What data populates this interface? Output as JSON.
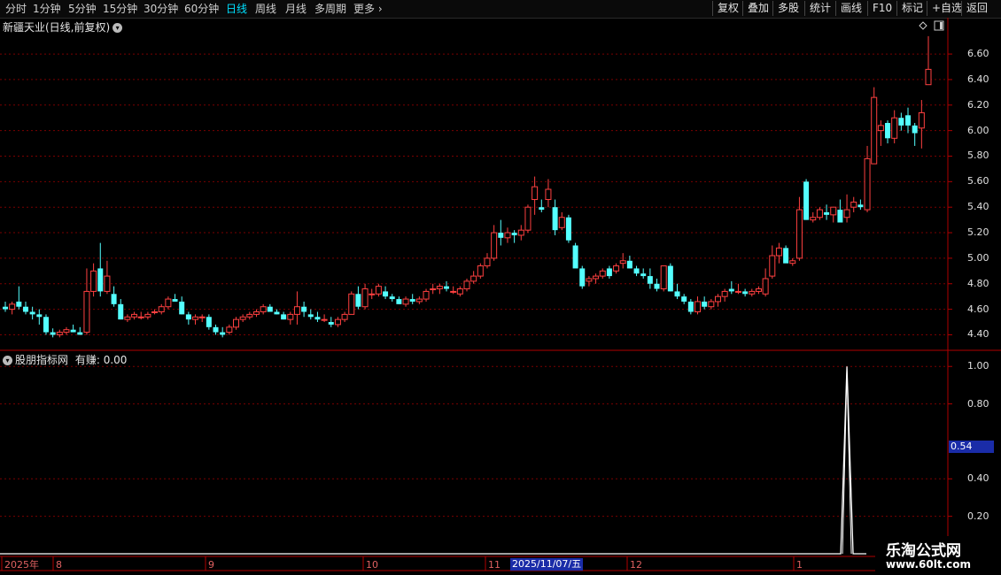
{
  "toolbar": {
    "periods": [
      "分时",
      "1分钟",
      "5分钟",
      "15分钟",
      "30分钟",
      "60分钟",
      "日线",
      "周线",
      "月线",
      "多周期",
      "更多"
    ],
    "active_period": "日线",
    "right_buttons": [
      "复权",
      "叠加",
      "多股",
      "统计",
      "画线",
      "F10",
      "标记",
      "+自选",
      "返回"
    ]
  },
  "main_chart": {
    "title": "新疆天业(日线,前复权)",
    "y_ticks": [
      "6.60",
      "6.40",
      "6.20",
      "6.00",
      "5.80",
      "5.60",
      "5.40",
      "5.20",
      "5.00",
      "4.80",
      "4.60",
      "4.40"
    ]
  },
  "indicator": {
    "title": "股朋指标网",
    "series_label": "有赚: 0.00",
    "y_ticks": [
      "1.00",
      "0.80",
      "0.40",
      "0.20"
    ],
    "cursor_value": "0.54"
  },
  "x_axis": {
    "labels": [
      "2025年",
      "8",
      "9",
      "10",
      "11",
      "12",
      "1"
    ],
    "highlight_date": "2025/11/07/五"
  },
  "watermark": {
    "name": "乐淘公式网",
    "url": "www.60lt.com"
  },
  "colors": {
    "up": "#ff4040",
    "down": "#54ffff",
    "grid": "#7a0000",
    "border": "#b00000"
  },
  "chart_data": {
    "type": "candlestick",
    "ylim": [
      4.32,
      6.76
    ],
    "candles": [
      [
        4.62,
        4.66,
        4.58,
        4.6
      ],
      [
        4.6,
        4.66,
        4.56,
        4.64
      ],
      [
        4.66,
        4.78,
        4.6,
        4.62
      ],
      [
        4.62,
        4.66,
        4.56,
        4.58
      ],
      [
        4.58,
        4.62,
        4.52,
        4.56
      ],
      [
        4.56,
        4.6,
        4.48,
        4.54
      ],
      [
        4.54,
        4.56,
        4.4,
        4.42
      ],
      [
        4.42,
        4.45,
        4.38,
        4.4
      ],
      [
        4.4,
        4.44,
        4.38,
        4.42
      ],
      [
        4.42,
        4.46,
        4.4,
        4.44
      ],
      [
        4.44,
        4.48,
        4.42,
        4.42
      ],
      [
        4.42,
        4.46,
        4.4,
        4.4
      ],
      [
        4.42,
        4.92,
        4.4,
        4.74
      ],
      [
        4.74,
        4.96,
        4.7,
        4.9
      ],
      [
        4.92,
        5.12,
        4.7,
        4.74
      ],
      [
        4.74,
        4.98,
        4.72,
        4.86
      ],
      [
        4.72,
        4.78,
        4.62,
        4.64
      ],
      [
        4.64,
        4.68,
        4.52,
        4.52
      ],
      [
        4.52,
        4.56,
        4.5,
        4.54
      ],
      [
        4.54,
        4.58,
        4.52,
        4.56
      ],
      [
        4.54,
        4.58,
        4.52,
        4.54
      ],
      [
        4.54,
        4.58,
        4.52,
        4.56
      ],
      [
        4.58,
        4.6,
        4.56,
        4.58
      ],
      [
        4.58,
        4.64,
        4.56,
        4.62
      ],
      [
        4.62,
        4.7,
        4.6,
        4.68
      ],
      [
        4.68,
        4.72,
        4.66,
        4.66
      ],
      [
        4.66,
        4.7,
        4.56,
        4.56
      ],
      [
        4.56,
        4.58,
        4.48,
        4.52
      ],
      [
        4.52,
        4.56,
        4.48,
        4.54
      ],
      [
        4.54,
        4.56,
        4.5,
        4.54
      ],
      [
        4.54,
        4.56,
        4.44,
        4.46
      ],
      [
        4.46,
        4.48,
        4.4,
        4.42
      ],
      [
        4.42,
        4.46,
        4.38,
        4.4
      ],
      [
        4.42,
        4.48,
        4.4,
        4.46
      ],
      [
        4.46,
        4.54,
        4.44,
        4.52
      ],
      [
        4.52,
        4.56,
        4.5,
        4.54
      ],
      [
        4.54,
        4.58,
        4.52,
        4.56
      ],
      [
        4.56,
        4.6,
        4.54,
        4.58
      ],
      [
        4.58,
        4.64,
        4.56,
        4.62
      ],
      [
        4.62,
        4.64,
        4.58,
        4.58
      ],
      [
        4.58,
        4.6,
        4.56,
        4.56
      ],
      [
        4.56,
        4.58,
        4.52,
        4.52
      ],
      [
        4.52,
        4.58,
        4.48,
        4.56
      ],
      [
        4.56,
        4.74,
        4.48,
        4.62
      ],
      [
        4.62,
        4.66,
        4.54,
        4.58
      ],
      [
        4.56,
        4.6,
        4.52,
        4.54
      ],
      [
        4.54,
        4.58,
        4.5,
        4.52
      ],
      [
        4.52,
        4.56,
        4.5,
        4.52
      ],
      [
        4.5,
        4.54,
        4.46,
        4.48
      ],
      [
        4.48,
        4.54,
        4.46,
        4.52
      ],
      [
        4.52,
        4.58,
        4.5,
        4.56
      ],
      [
        4.56,
        4.74,
        4.56,
        4.72
      ],
      [
        4.72,
        4.78,
        4.6,
        4.62
      ],
      [
        4.62,
        4.8,
        4.6,
        4.76
      ],
      [
        4.72,
        4.76,
        4.68,
        4.72
      ],
      [
        4.72,
        4.8,
        4.7,
        4.78
      ],
      [
        4.74,
        4.78,
        4.68,
        4.7
      ],
      [
        4.7,
        4.72,
        4.66,
        4.68
      ],
      [
        4.68,
        4.7,
        4.64,
        4.64
      ],
      [
        4.64,
        4.7,
        4.62,
        4.68
      ],
      [
        4.68,
        4.72,
        4.64,
        4.66
      ],
      [
        4.66,
        4.7,
        4.64,
        4.68
      ],
      [
        4.68,
        4.76,
        4.66,
        4.74
      ],
      [
        4.76,
        4.8,
        4.72,
        4.76
      ],
      [
        4.76,
        4.8,
        4.72,
        4.78
      ],
      [
        4.78,
        4.82,
        4.74,
        4.76
      ],
      [
        4.74,
        4.78,
        4.72,
        4.74
      ],
      [
        4.72,
        4.78,
        4.7,
        4.76
      ],
      [
        4.76,
        4.84,
        4.74,
        4.82
      ],
      [
        4.82,
        4.9,
        4.8,
        4.86
      ],
      [
        4.86,
        4.96,
        4.84,
        4.94
      ],
      [
        4.94,
        5.04,
        4.92,
        5.0
      ],
      [
        5.0,
        5.26,
        4.98,
        5.2
      ],
      [
        5.2,
        5.3,
        5.1,
        5.16
      ],
      [
        5.16,
        5.24,
        5.12,
        5.2
      ],
      [
        5.2,
        5.22,
        5.12,
        5.18
      ],
      [
        5.18,
        5.26,
        5.14,
        5.22
      ],
      [
        5.22,
        5.42,
        5.2,
        5.4
      ],
      [
        5.46,
        5.64,
        5.34,
        5.56
      ],
      [
        5.4,
        5.46,
        5.36,
        5.38
      ],
      [
        5.46,
        5.62,
        5.4,
        5.54
      ],
      [
        5.4,
        5.46,
        5.18,
        5.22
      ],
      [
        5.24,
        5.36,
        5.22,
        5.32
      ],
      [
        5.32,
        5.34,
        5.12,
        5.14
      ],
      [
        5.1,
        5.12,
        4.94,
        4.92
      ],
      [
        4.92,
        4.94,
        4.76,
        4.78
      ],
      [
        4.82,
        4.86,
        4.78,
        4.84
      ],
      [
        4.84,
        4.88,
        4.8,
        4.86
      ],
      [
        4.86,
        4.92,
        4.84,
        4.9
      ],
      [
        4.92,
        4.94,
        4.84,
        4.86
      ],
      [
        4.9,
        4.96,
        4.88,
        4.94
      ],
      [
        4.96,
        5.04,
        4.92,
        4.98
      ],
      [
        4.98,
        5.02,
        4.92,
        4.92
      ],
      [
        4.92,
        4.94,
        4.86,
        4.88
      ],
      [
        4.88,
        4.92,
        4.84,
        4.86
      ],
      [
        4.86,
        4.92,
        4.76,
        4.8
      ],
      [
        4.8,
        4.84,
        4.74,
        4.76
      ],
      [
        4.76,
        4.78,
        4.74,
        4.94
      ],
      [
        4.94,
        4.96,
        4.74,
        4.74
      ],
      [
        4.74,
        4.8,
        4.68,
        4.7
      ],
      [
        4.7,
        4.72,
        4.64,
        4.66
      ],
      [
        4.66,
        4.68,
        4.56,
        4.58
      ],
      [
        4.58,
        4.7,
        4.56,
        4.66
      ],
      [
        4.66,
        4.7,
        4.6,
        4.62
      ],
      [
        4.62,
        4.68,
        4.6,
        4.66
      ],
      [
        4.66,
        4.72,
        4.62,
        4.7
      ],
      [
        4.7,
        4.76,
        4.66,
        4.74
      ],
      [
        4.76,
        4.82,
        4.72,
        4.74
      ],
      [
        4.74,
        4.8,
        4.72,
        4.74
      ],
      [
        4.74,
        4.76,
        4.7,
        4.72
      ],
      [
        4.72,
        4.76,
        4.7,
        4.74
      ],
      [
        4.74,
        4.78,
        4.72,
        4.76
      ],
      [
        4.72,
        4.92,
        4.7,
        4.84
      ],
      [
        4.86,
        5.1,
        4.84,
        5.02
      ],
      [
        5.02,
        5.12,
        4.96,
        5.08
      ],
      [
        5.08,
        5.1,
        5.0,
        4.96
      ],
      [
        4.96,
        5.0,
        4.94,
        4.98
      ],
      [
        5.0,
        5.48,
        4.98,
        5.38
      ],
      [
        5.6,
        5.62,
        5.3,
        5.3
      ],
      [
        5.3,
        5.36,
        5.28,
        5.32
      ],
      [
        5.32,
        5.4,
        5.3,
        5.38
      ],
      [
        5.36,
        5.42,
        5.3,
        5.34
      ],
      [
        5.34,
        5.4,
        5.28,
        5.4
      ],
      [
        5.38,
        5.46,
        5.3,
        5.28
      ],
      [
        5.32,
        5.5,
        5.28,
        5.38
      ],
      [
        5.4,
        5.48,
        5.36,
        5.44
      ],
      [
        5.42,
        5.46,
        5.38,
        5.4
      ],
      [
        5.38,
        5.88,
        5.36,
        5.78
      ],
      [
        5.74,
        6.34,
        5.74,
        6.26
      ],
      [
        6.0,
        6.08,
        5.88,
        6.04
      ],
      [
        6.06,
        6.08,
        5.9,
        5.94
      ],
      [
        5.94,
        6.16,
        5.9,
        6.1
      ],
      [
        6.1,
        6.14,
        6.0,
        6.04
      ],
      [
        6.12,
        6.18,
        5.98,
        6.04
      ],
      [
        6.04,
        6.06,
        5.88,
        5.98
      ],
      [
        6.02,
        6.24,
        5.86,
        6.14
      ],
      [
        6.36,
        6.74,
        6.36,
        6.48
      ]
    ],
    "indicator": {
      "name": "有赚",
      "peak_index": 124,
      "peak_value": 1.0,
      "baseline": 0.0,
      "ylim": [
        0.0,
        1.02
      ]
    }
  }
}
